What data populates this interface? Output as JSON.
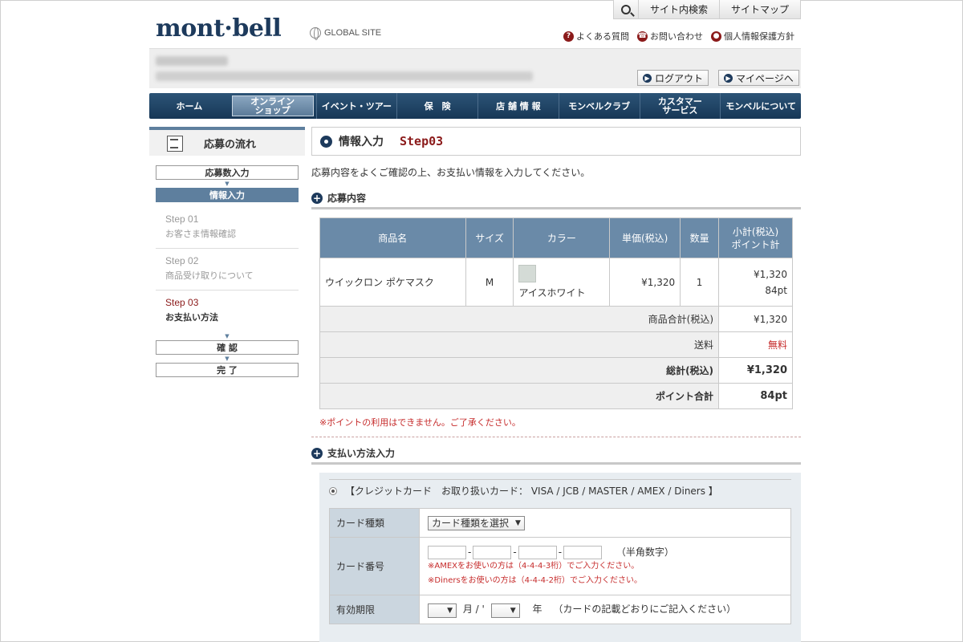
{
  "header": {
    "logo": "mont·bell",
    "global_site": "GLOBAL SITE",
    "site_search": "サイト内検索",
    "site_map": "サイトマップ",
    "faq": "よくある質問",
    "contact": "お問い合わせ",
    "privacy": "個人情報保護方針"
  },
  "userbar": {
    "logout": "ログアウト",
    "mypage": "マイページへ"
  },
  "nav": [
    {
      "label": "ホーム"
    },
    {
      "label": "オンライン\nショップ"
    },
    {
      "label": "イベント・ツアー"
    },
    {
      "label": "保　険"
    },
    {
      "label": "店 舗 情 報"
    },
    {
      "label": "モンベルクラブ"
    },
    {
      "label": "カスタマー\nサービス"
    },
    {
      "label": "モンベルについて"
    }
  ],
  "sidebar": {
    "title": "応募の流れ",
    "box1": "応募数入力",
    "box2": "情報入力",
    "steps": [
      {
        "num": "Step 01",
        "text": "お客さま情報確認"
      },
      {
        "num": "Step 02",
        "text": "商品受け取りについて"
      },
      {
        "num": "Step 03",
        "text": "お支払い方法"
      }
    ],
    "box3": "確 認",
    "box4": "完 了"
  },
  "main": {
    "title": "情報入力",
    "step": "Step03",
    "intro": "応募内容をよくご確認の上、お支払い情報を入力してください。",
    "section1": "応募内容",
    "table": {
      "headers": [
        "商品名",
        "サイズ",
        "カラー",
        "単価(税込)",
        "数量",
        "小計(税込)\nポイント計"
      ],
      "row": {
        "name": "ウイックロン ポケマスク",
        "size": "M",
        "color": "アイスホワイト",
        "price": "¥1,320",
        "qty": "1",
        "subtotal": "¥1,320",
        "points": "84pt"
      },
      "summary": [
        {
          "label": "商品合計(税込)",
          "value": "¥1,320"
        },
        {
          "label": "送料",
          "value": "無料"
        },
        {
          "label": "総計(税込)",
          "value": "¥1,320"
        },
        {
          "label": "ポイント合計",
          "value": "84pt"
        }
      ]
    },
    "note": "※ポイントの利用はできません。ご了承ください。",
    "section2": "支払い方法入力",
    "payment": {
      "option": "【クレジットカード　お取り扱いカード： VISA / JCB / MASTER / AMEX / Diners 】",
      "card_type_label": "カード種類",
      "card_type_select": "カード種類を選択",
      "card_number_label": "カード番号",
      "card_number_hint": "（半角数字）",
      "amex_note": "※AMEXをお使いの方は（4-4-4-3桁）でご入力ください。",
      "diners_note": "※Dinersをお使いの方は（4-4-4-2桁）でご入力ください。",
      "expiry_label": "有効期限",
      "month_unit": "月 / '",
      "year_unit": "年",
      "expiry_hint": "（カードの記載どおりにご記入ください）"
    }
  }
}
